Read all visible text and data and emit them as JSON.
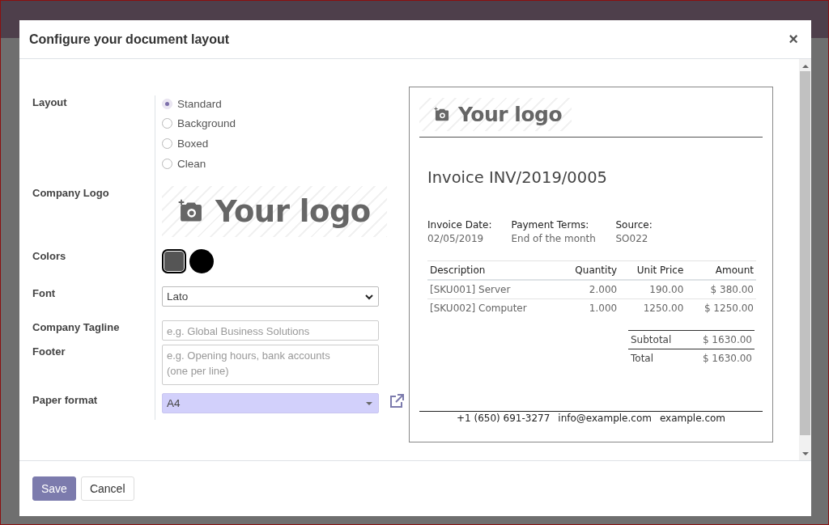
{
  "dialog": {
    "title": "Configure your document layout",
    "close": "×",
    "form": [
      {
        "kind": "radio",
        "label": "Layout",
        "options": [
          {
            "label": "Standard",
            "selected": true
          },
          {
            "label": "Background",
            "selected": false
          },
          {
            "label": "Boxed",
            "selected": false
          },
          {
            "label": "Clean",
            "selected": false
          }
        ]
      },
      {
        "kind": "logo",
        "label": "Company Logo",
        "logo_text": "Your logo"
      },
      {
        "kind": "colors",
        "label": "Colors",
        "swatches": [
          {
            "color": "#555555",
            "selected": true
          },
          {
            "color": "#000000",
            "selected": false
          }
        ]
      },
      {
        "kind": "select",
        "label": "Font",
        "value": "Lato"
      },
      {
        "kind": "input",
        "label": "Company Tagline",
        "placeholder": "e.g. Global Business Solutions"
      },
      {
        "kind": "textarea",
        "label": "Footer",
        "placeholder": "e.g. Opening hours, bank accounts (one per line)"
      },
      {
        "kind": "paper",
        "label": "Paper format",
        "value": "A4"
      }
    ],
    "preview": {
      "logo_text": "Your logo",
      "title": "Invoice INV/2019/0005",
      "info": [
        {
          "label": "Invoice Date:",
          "value": "02/05/2019"
        },
        {
          "label": "Payment Terms:",
          "value": "End of the month"
        },
        {
          "label": "Source:",
          "value": "SO022"
        }
      ],
      "columns": [
        "Description",
        "Quantity",
        "Unit Price",
        "Amount"
      ],
      "rows": [
        [
          "[SKU001] Server",
          "2.000",
          "190.00",
          "$ 380.00"
        ],
        [
          "[SKU002] Computer",
          "1.000",
          "1250.00",
          "$ 1250.00"
        ]
      ],
      "totals": [
        {
          "label": "Subtotal",
          "value": "$ 1630.00"
        },
        {
          "label": "Total",
          "value": "$ 1630.00"
        }
      ],
      "contacts": [
        "+1 (650) 691-3277",
        "info@example.com",
        "example.com"
      ]
    },
    "buttons": [
      {
        "label": "Save",
        "kind": "primary"
      },
      {
        "label": "Cancel",
        "kind": "secondary"
      }
    ]
  }
}
